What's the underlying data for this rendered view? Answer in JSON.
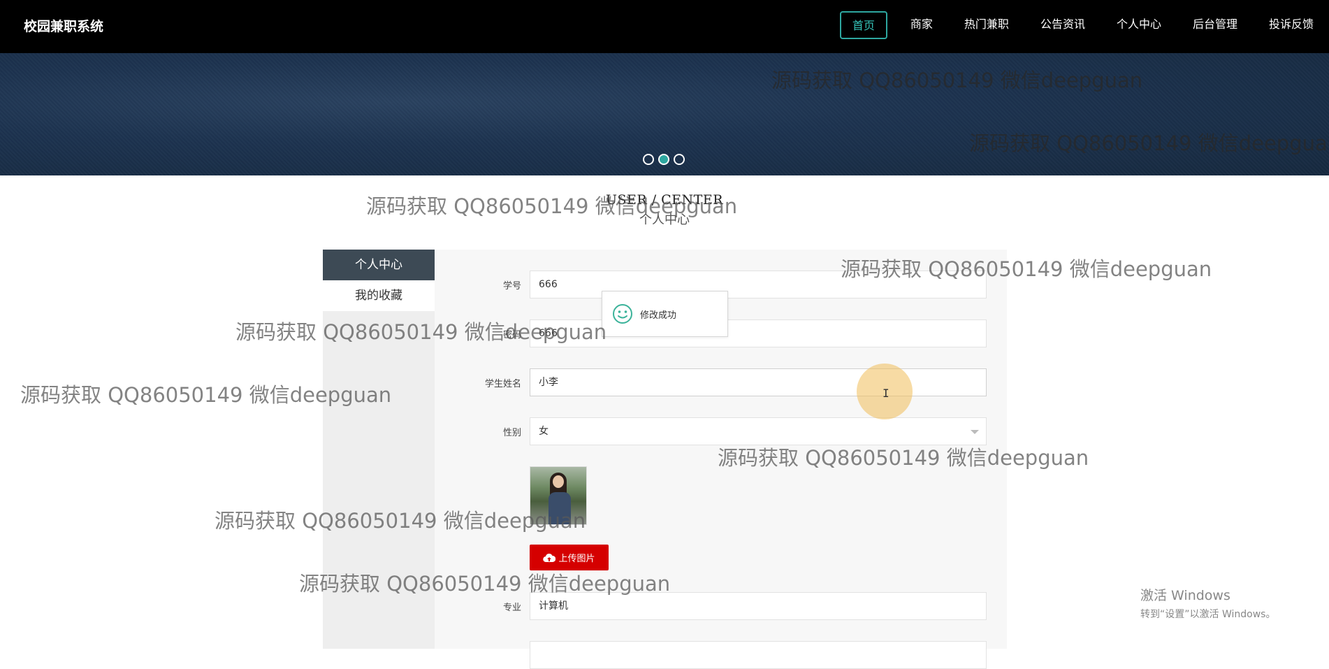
{
  "header": {
    "brand": "校园兼职系统",
    "nav": [
      {
        "label": "首页",
        "active": true
      },
      {
        "label": "商家"
      },
      {
        "label": "热门兼职"
      },
      {
        "label": "公告资讯"
      },
      {
        "label": "个人中心"
      },
      {
        "label": "后台管理"
      },
      {
        "label": "投诉反馈"
      }
    ]
  },
  "banner": {
    "slides": 3,
    "active_slide": 2
  },
  "section": {
    "title_en": "USER / CENTER",
    "title_cn": "个人中心"
  },
  "sidebar": {
    "items": [
      {
        "label": "个人中心",
        "active": true
      },
      {
        "label": "我的收藏"
      }
    ]
  },
  "form": {
    "student_id": {
      "label": "学号",
      "value": "666"
    },
    "password": {
      "label": "密码",
      "value": "666"
    },
    "name": {
      "label": "学生姓名",
      "value": "小李"
    },
    "gender": {
      "label": "性别",
      "value": "女"
    },
    "upload_label": "上传图片",
    "major": {
      "label": "专业",
      "value": "计算机"
    }
  },
  "toast": {
    "message": "修改成功"
  },
  "watermark": "源码获取 QQ86050149 微信deepguan",
  "windows": {
    "line1": "激活 Windows",
    "line2": "转到“设置”以激活 Windows。"
  },
  "colors": {
    "accent": "#2ea7a0",
    "upload": "#d50000",
    "sidebar_active": "#3d4a55"
  }
}
